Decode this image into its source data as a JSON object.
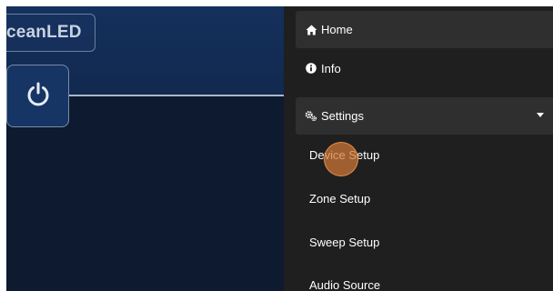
{
  "brand": {
    "logo_text": "ceanLED"
  },
  "controls": {
    "power_icon": "power-icon"
  },
  "nav": {
    "home": {
      "label": "Home",
      "icon": "home-icon"
    },
    "info": {
      "label": "Info",
      "icon": "info-icon"
    },
    "settings": {
      "label": "Settings",
      "icon": "gears-icon",
      "expanded": true,
      "subitems": [
        {
          "label": "Device Setup"
        },
        {
          "label": "Zone Setup"
        },
        {
          "label": "Sweep Setup"
        },
        {
          "label": "Audio Source"
        }
      ]
    }
  },
  "colors": {
    "sidebar_bg": "#1f1f1f",
    "active_item_bg": "#2f2f2f",
    "header_bg": "#14305c",
    "body_bg": "#0d1a30",
    "touch_indicator": "#d27837"
  }
}
